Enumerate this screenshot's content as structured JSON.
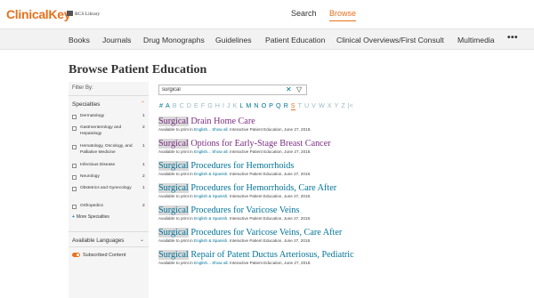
{
  "header": {
    "logo": "ClinicalKey",
    "logo_sub": "RCS Library",
    "links": [
      {
        "label": "Search",
        "active": false
      },
      {
        "label": "Browse",
        "active": true
      }
    ]
  },
  "nav": {
    "items": [
      "Books",
      "Journals",
      "Drug Monographs",
      "Guidelines",
      "Patient Education",
      "Clinical Overviews/First Consult",
      "Multimedia"
    ],
    "more": "•••"
  },
  "page_title": "Browse Patient Education",
  "sidebar": {
    "filter_by": "Filter By:",
    "specialties_label": "Specialties",
    "specialties": [
      {
        "label": "Dermatology",
        "count": "1"
      },
      {
        "label": "Gastroenterology and Hepatology",
        "count": "2"
      },
      {
        "label": "Hematology, Oncology, and Palliative Medicine",
        "count": "1"
      },
      {
        "label": "Infectious Disease",
        "count": "1"
      },
      {
        "label": "Neurology",
        "count": "2"
      },
      {
        "label": "Obstetrics and Gynecology",
        "count": "1"
      },
      {
        "label": "Orthopedics",
        "count": "2"
      }
    ],
    "more_specialties": "More Specialties",
    "languages_label": "Available Languages",
    "subscribed_label": "Subscribed Content"
  },
  "search": {
    "value": "surgical",
    "placeholder": ""
  },
  "alphabet": {
    "letters": [
      "#",
      "A",
      "B",
      "C",
      "D",
      "E",
      "F",
      "G",
      "H",
      "I",
      "J",
      "K",
      "L",
      "M",
      "N",
      "O",
      "P",
      "Q",
      "R",
      "S",
      "T",
      "U",
      "V",
      "W",
      "X",
      "Y",
      "Z",
      "|<"
    ],
    "enabled": [
      "#",
      "A",
      "L",
      "M",
      "N",
      "O",
      "P",
      "Q",
      "R",
      "S"
    ],
    "selected": "S"
  },
  "results": [
    {
      "highlight": "Surgical",
      "rest": " Drain Home Care",
      "title_color": "#7a2c82",
      "meta_prefix": "Available to print in ",
      "meta_lang": "English...",
      "meta_show": " Show all.",
      "meta_suffix": " Interactive Patient Education, June 27, 2018."
    },
    {
      "highlight": "Surgical",
      "rest": " Options for Early-Stage Breast Cancer",
      "title_color": "#7a2c82",
      "meta_prefix": "Available to print in ",
      "meta_lang": "English...",
      "meta_show": " Show all.",
      "meta_suffix": " Interactive Patient Education, June 27, 2018."
    },
    {
      "highlight": "Surgical",
      "rest": " Procedures for Hemorrhoids",
      "title_color": "#007398",
      "meta_prefix": "Available to print in ",
      "meta_lang": "English & Spanish.",
      "meta_show": "",
      "meta_suffix": " Interactive Patient Education, June 27, 2018."
    },
    {
      "highlight": "Surgical",
      "rest": " Procedures for Hemorrhoids, Care After",
      "title_color": "#007398",
      "meta_prefix": "Available to print in ",
      "meta_lang": "English & Spanish.",
      "meta_show": "",
      "meta_suffix": " Interactive Patient Education, June 27, 2018."
    },
    {
      "highlight": "Surgical",
      "rest": " Procedures for Varicose Veins",
      "title_color": "#007398",
      "meta_prefix": "Available to print in ",
      "meta_lang": "English & Spanish.",
      "meta_show": "",
      "meta_suffix": " Interactive Patient Education, June 27, 2018."
    },
    {
      "highlight": "Surgical",
      "rest": " Procedures for Varicose Veins, Care After",
      "title_color": "#007398",
      "meta_prefix": "Available to print in ",
      "meta_lang": "English & Spanish.",
      "meta_show": "",
      "meta_suffix": " Interactive Patient Education, June 27, 2018."
    },
    {
      "highlight": "Surgical",
      "rest": " Repair of Patent Ductus Arteriosus, Pediatric",
      "title_color": "#007398",
      "meta_prefix": "Available to print in ",
      "meta_lang": "English...",
      "meta_show": " Show all.",
      "meta_suffix": " Interactive Patient Education, June 27, 2018."
    }
  ],
  "colors": {
    "accent": "#e9711c",
    "link": "#007398",
    "visited": "#7a2c82"
  }
}
